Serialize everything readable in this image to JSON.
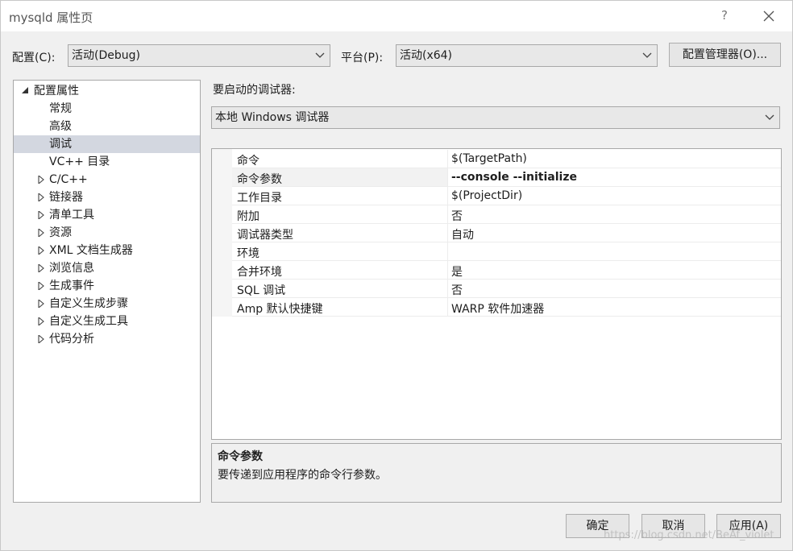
{
  "window": {
    "title": "mysqld 属性页",
    "help_glyph": "?",
    "close_icon": "close-icon"
  },
  "toolbar": {
    "config_label": "配置(C):",
    "config_value": "活动(Debug)",
    "platform_label": "平台(P):",
    "platform_value": "活动(x64)",
    "config_manager_label": "配置管理器(O)..."
  },
  "tree": {
    "root_label": "配置属性",
    "items": [
      {
        "label": "常规",
        "expandable": false,
        "selected": false
      },
      {
        "label": "高级",
        "expandable": false,
        "selected": false
      },
      {
        "label": "调试",
        "expandable": false,
        "selected": true
      },
      {
        "label": "VC++ 目录",
        "expandable": false,
        "selected": false
      },
      {
        "label": "C/C++",
        "expandable": true,
        "selected": false
      },
      {
        "label": "链接器",
        "expandable": true,
        "selected": false
      },
      {
        "label": "清单工具",
        "expandable": true,
        "selected": false
      },
      {
        "label": "资源",
        "expandable": true,
        "selected": false
      },
      {
        "label": "XML 文档生成器",
        "expandable": true,
        "selected": false
      },
      {
        "label": "浏览信息",
        "expandable": true,
        "selected": false
      },
      {
        "label": "生成事件",
        "expandable": true,
        "selected": false
      },
      {
        "label": "自定义生成步骤",
        "expandable": true,
        "selected": false
      },
      {
        "label": "自定义生成工具",
        "expandable": true,
        "selected": false
      },
      {
        "label": "代码分析",
        "expandable": true,
        "selected": false
      }
    ]
  },
  "debugger": {
    "label": "要启动的调试器:",
    "value": "本地 Windows 调试器"
  },
  "properties": [
    {
      "name": "命令",
      "value": "$(TargetPath)",
      "bold": false,
      "selected": false
    },
    {
      "name": "命令参数",
      "value": "--console --initialize",
      "bold": true,
      "selected": true
    },
    {
      "name": "工作目录",
      "value": "$(ProjectDir)",
      "bold": false,
      "selected": false
    },
    {
      "name": "附加",
      "value": "否",
      "bold": false,
      "selected": false
    },
    {
      "name": "调试器类型",
      "value": "自动",
      "bold": false,
      "selected": false
    },
    {
      "name": "环境",
      "value": "",
      "bold": false,
      "selected": false
    },
    {
      "name": "合并环境",
      "value": "是",
      "bold": false,
      "selected": false
    },
    {
      "name": "SQL 调试",
      "value": "否",
      "bold": false,
      "selected": false
    },
    {
      "name": "Amp 默认快捷键",
      "value": "WARP 软件加速器",
      "bold": false,
      "selected": false
    }
  ],
  "description": {
    "title": "命令参数",
    "text": "要传递到应用程序的命令行参数。"
  },
  "buttons": {
    "ok": "确定",
    "cancel": "取消",
    "apply": "应用(A)"
  },
  "watermark": "https://blog.csdn.net/BeAf_violet"
}
